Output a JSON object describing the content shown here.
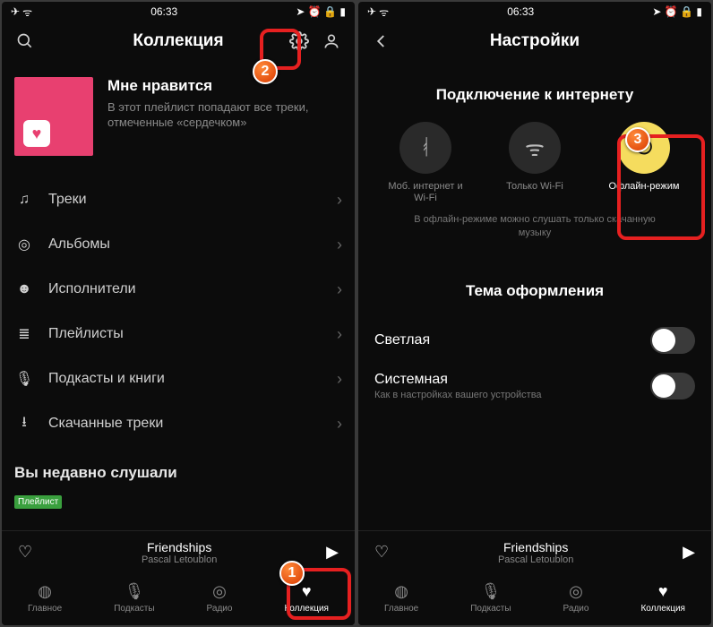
{
  "status": {
    "time": "06:33",
    "airplane": "✈",
    "wifi": "ᯤ",
    "nav": "➤",
    "alarm": "⏰",
    "lock": "🔒",
    "battery": "▮"
  },
  "left": {
    "title": "Коллекция",
    "likes": {
      "title": "Мне нравится",
      "sub": "В этот плейлист попадают все треки, отмеченные «сердечком»"
    },
    "menu": [
      {
        "icon": "♫",
        "label": "Треки"
      },
      {
        "icon": "◎",
        "label": "Альбомы"
      },
      {
        "icon": "☻",
        "label": "Исполнители"
      },
      {
        "icon": "≣",
        "label": "Плейлисты"
      },
      {
        "icon": "🎙",
        "label": "Подкасты и книги"
      },
      {
        "icon": "⭳",
        "label": "Скачанные треки"
      }
    ],
    "recent_title": "Вы недавно слушали",
    "recent_chip": "Плейлист"
  },
  "right": {
    "title": "Настройки",
    "section_conn": "Подключение к интернету",
    "conn": [
      {
        "icon": "ᚮ",
        "label": "Моб. интернет и Wi-Fi"
      },
      {
        "icon": "ᯤ",
        "label": "Только Wi-Fi"
      },
      {
        "icon": "⏻",
        "label": "Офлайн-режим",
        "active": true
      }
    ],
    "conn_note": "В офлайн-режиме можно слушать только скачанную музыку",
    "section_theme": "Тема оформления",
    "themes": [
      {
        "label": "Светлая",
        "sub": ""
      },
      {
        "label": "Системная",
        "sub": "Как в настройках вашего устройства"
      }
    ]
  },
  "nowplaying": {
    "track": "Friendships",
    "artist": "Pascal Letoublon"
  },
  "tabs": [
    {
      "icon": "◍",
      "label": "Главное"
    },
    {
      "icon": "🎙",
      "label": "Подкасты"
    },
    {
      "icon": "◎",
      "label": "Радио"
    },
    {
      "icon": "♥",
      "label": "Коллекция",
      "active": true
    }
  ],
  "badges": {
    "one": "1",
    "two": "2",
    "three": "3"
  }
}
